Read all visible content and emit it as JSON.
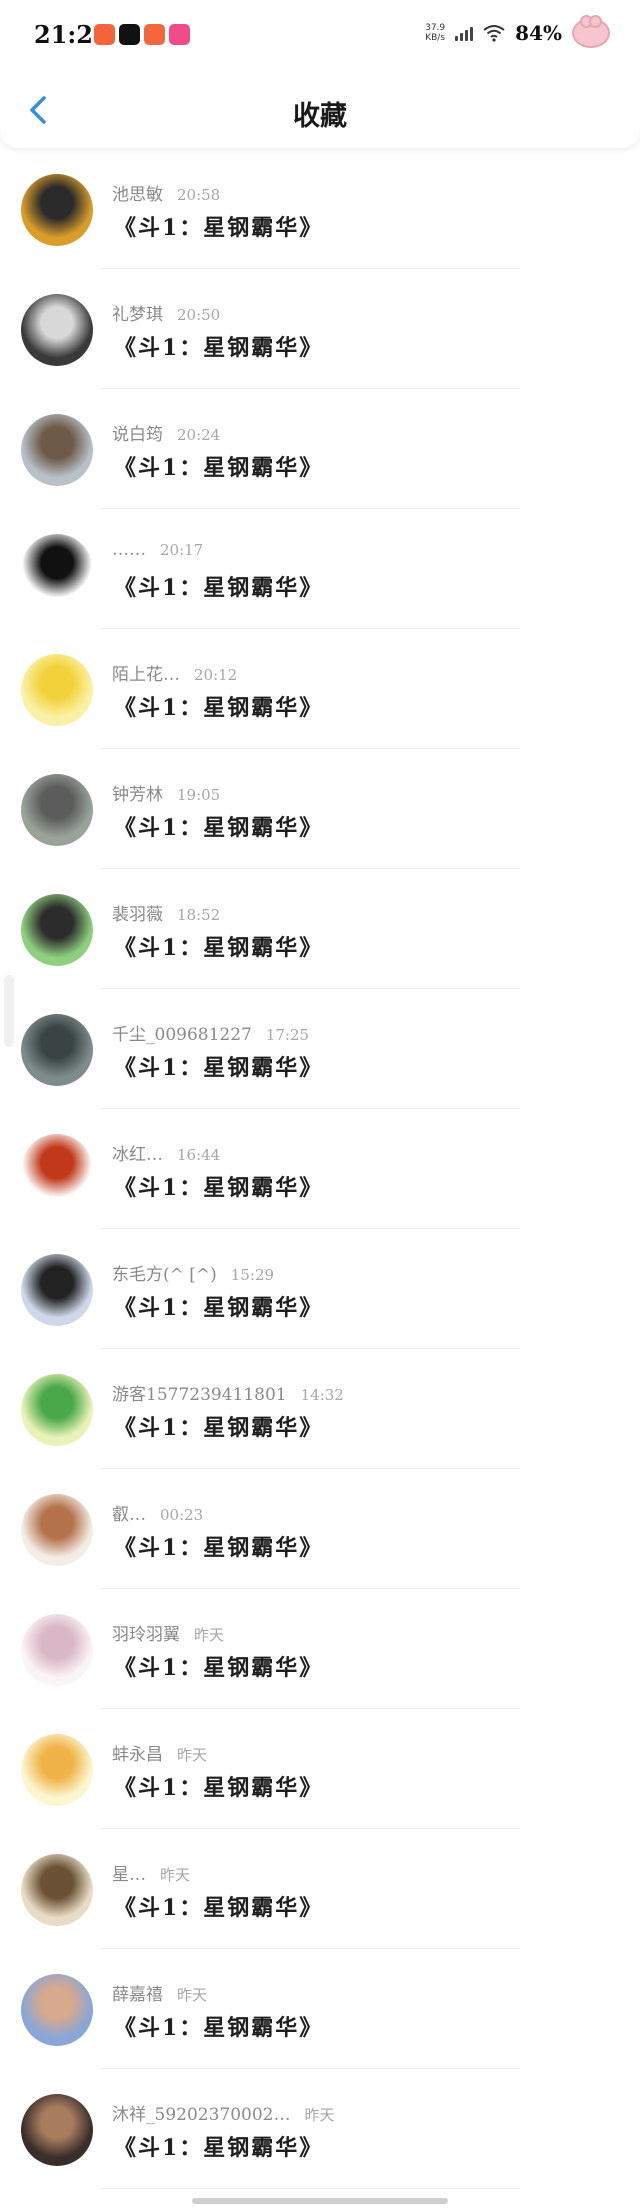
{
  "status_bar": {
    "time": "21:23",
    "net_speed_value": "37.9",
    "net_speed_unit": "KB/s",
    "battery": "84%",
    "app_icons": [
      {
        "name": "app-icon-1",
        "color": "#f4643a"
      },
      {
        "name": "tiktok-icon",
        "color": "#111111"
      },
      {
        "name": "app-icon-3",
        "color": "#f2683c"
      },
      {
        "name": "app-icon-4",
        "color": "#f24b8a"
      }
    ]
  },
  "nav": {
    "title": "收藏",
    "back_icon": "chevron-left-icon",
    "accent": "#2f8fe8"
  },
  "items": [
    {
      "name": "池思敏",
      "time": "20:58",
      "title": "《斗1：星钢霸华》",
      "avatar_colors": [
        "#d99d2b",
        "#2a2a2a"
      ]
    },
    {
      "name": "礼梦琪",
      "time": "20:50",
      "title": "《斗1：星钢霸华》",
      "avatar_colors": [
        "#3a3a3a",
        "#d8d8d8"
      ]
    },
    {
      "name": "说白筠",
      "time": "20:24",
      "title": "《斗1：星钢霸华》",
      "avatar_colors": [
        "#b8c0c8",
        "#6d5a48"
      ]
    },
    {
      "name": "……",
      "time": "20:17",
      "title": "《斗1：星钢霸华》",
      "avatar_colors": [
        "#ffffff",
        "#111111"
      ]
    },
    {
      "name": "陌上花…",
      "time": "20:12",
      "title": "《斗1：星钢霸华》",
      "avatar_colors": [
        "#fbf1a6",
        "#f2d23a"
      ]
    },
    {
      "name": "钟芳林",
      "time": "19:05",
      "title": "《斗1：星钢霸华》",
      "avatar_colors": [
        "#9aa39a",
        "#5c5c5c"
      ]
    },
    {
      "name": "裴羽薇",
      "time": "18:52",
      "title": "《斗1：星钢霸华》",
      "avatar_colors": [
        "#8fcf7f",
        "#2c2c2c"
      ]
    },
    {
      "name": "千尘_009681227",
      "time": "17:25",
      "title": "《斗1：星钢霸华》",
      "avatar_colors": [
        "#7f8c8c",
        "#3a4444"
      ]
    },
    {
      "name": "冰红…",
      "time": "16:44",
      "title": "《斗1：星钢霸华》",
      "avatar_colors": [
        "#ffffff",
        "#c0391b"
      ]
    },
    {
      "name": "东毛方(^ [^)",
      "time": "15:29",
      "title": "《斗1：星钢霸华》",
      "avatar_colors": [
        "#cfd8e8",
        "#222222"
      ]
    },
    {
      "name": "游客1577239411801",
      "time": "14:32",
      "title": "《斗1：星钢霸华》",
      "avatar_colors": [
        "#e9f2b8",
        "#4aa84a"
      ]
    },
    {
      "name": "叡…",
      "time": "00:23",
      "title": "《斗1：星钢霸华》",
      "avatar_colors": [
        "#f3ede6",
        "#b5734d"
      ]
    },
    {
      "name": "羽玲羽翼",
      "time": "昨天",
      "title": "《斗1：星钢霸华》",
      "avatar_colors": [
        "#fbf4f6",
        "#d9b7c4"
      ]
    },
    {
      "name": "蚌永昌",
      "time": "昨天",
      "title": "《斗1：星钢霸华》",
      "avatar_colors": [
        "#fbf6cf",
        "#f0b34a"
      ]
    },
    {
      "name": "星…",
      "time": "昨天",
      "title": "《斗1：星钢霸华》",
      "avatar_colors": [
        "#e8dcc6",
        "#6b5236"
      ]
    },
    {
      "name": "薛嘉禧",
      "time": "昨天",
      "title": "《斗1：星钢霸华》",
      "avatar_colors": [
        "#8aa6d6",
        "#d7a98e"
      ]
    },
    {
      "name": "沐祥_59202370002…",
      "time": "昨天",
      "title": "《斗1：星钢霸华》",
      "avatar_colors": [
        "#3a2e2a",
        "#a77d5d"
      ]
    }
  ]
}
